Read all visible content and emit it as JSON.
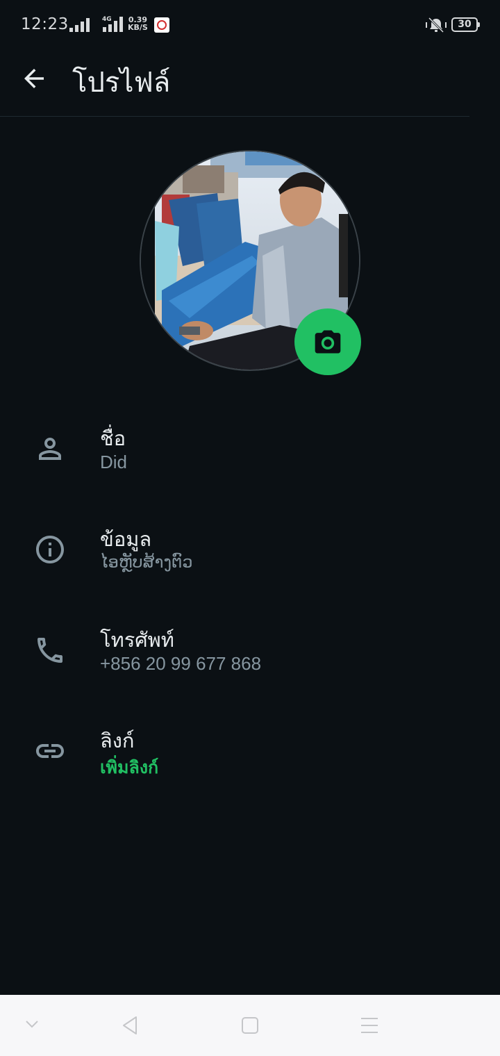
{
  "status_bar": {
    "time": "12:23",
    "network_type": "4G",
    "speed_value": "0.39",
    "speed_unit": "KB/S",
    "battery": "30"
  },
  "header": {
    "title": "โปรไฟล์"
  },
  "profile": {
    "rows": [
      {
        "label": "ชื่อ",
        "value": "Did",
        "icon": "person-icon"
      },
      {
        "label": "ข้อมูล",
        "value": "ໄອຫຼັບສ້າງຕົວ",
        "icon": "info-icon"
      },
      {
        "label": "โทรศัพท์",
        "value": "+856 20 99 677 868",
        "icon": "phone-icon"
      },
      {
        "label": "ลิงก์",
        "value": "เพิ่มลิงก์",
        "icon": "link-icon"
      }
    ]
  },
  "colors": {
    "background": "#0b1014",
    "accent": "#21c063",
    "secondary_text": "#8696a0",
    "primary_text": "#e9edef"
  }
}
